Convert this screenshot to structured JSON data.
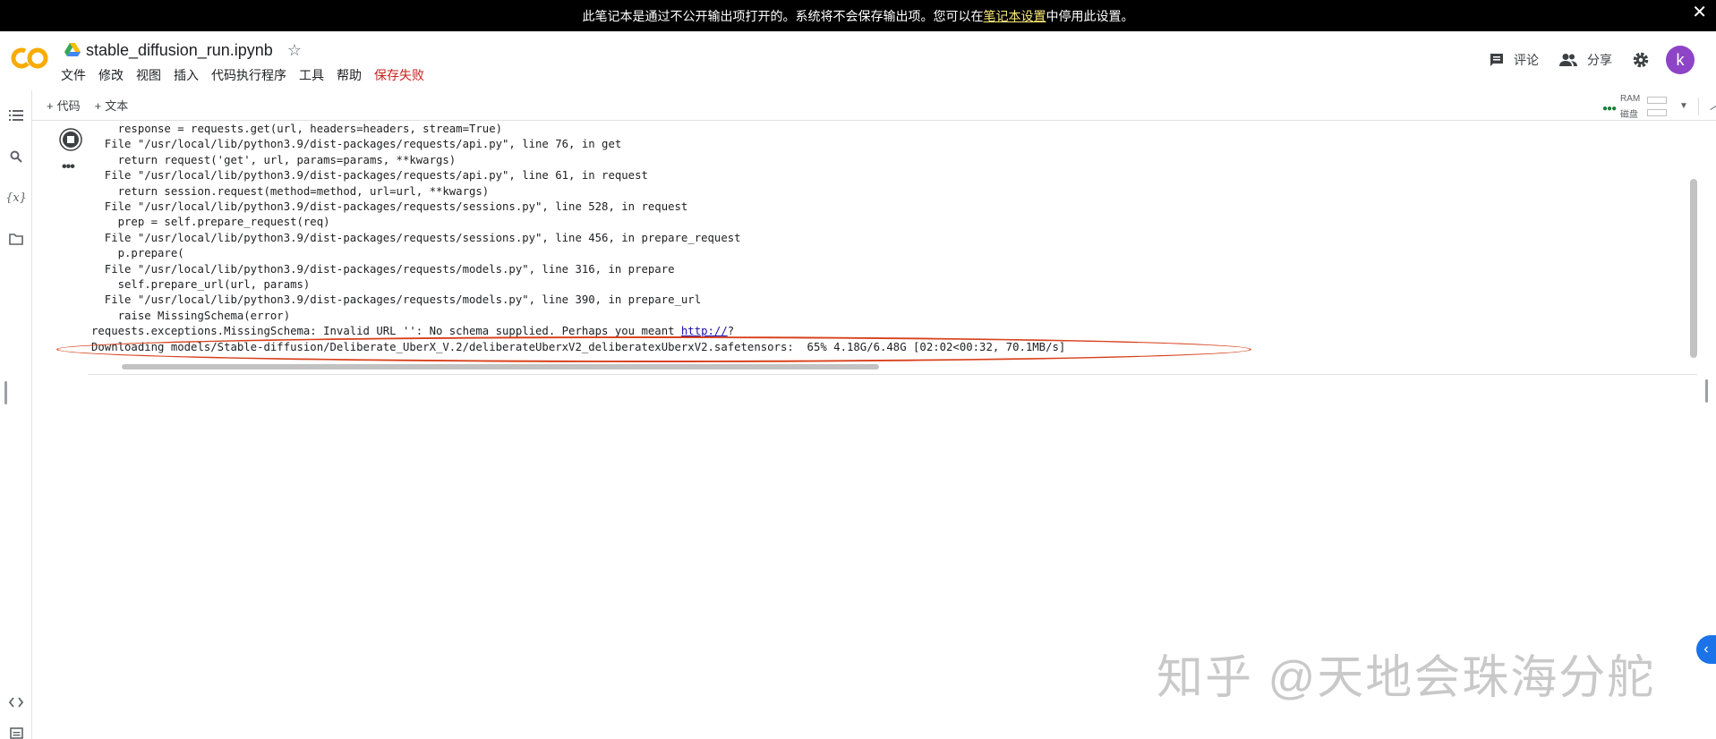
{
  "banner": {
    "text_before": "此笔记本是通过不公开输出项打开的。系统将不会保存输出项。您可以在",
    "link": "笔记本设置",
    "text_after": "中停用此设置。",
    "close": "✕"
  },
  "header": {
    "logo": "colab-logo",
    "notebook_title": "stable_diffusion_run.ipynb",
    "star": "☆",
    "menu": [
      "文件",
      "修改",
      "视图",
      "插入",
      "代码执行程序",
      "工具",
      "帮助"
    ],
    "save_status": "保存失败",
    "comment_label": "评论",
    "share_label": "分享",
    "avatar_letter": "k"
  },
  "toolbar": {
    "add_code": "代码",
    "add_text": "文本",
    "plus": "+",
    "ram_label": "RAM",
    "disk_label": "磁盘"
  },
  "output": {
    "lines": [
      "    response = requests.get(url, headers=headers, stream=True)",
      "  File \"/usr/local/lib/python3.9/dist-packages/requests/api.py\", line 76, in get",
      "    return request('get', url, params=params, **kwargs)",
      "  File \"/usr/local/lib/python3.9/dist-packages/requests/api.py\", line 61, in request",
      "    return session.request(method=method, url=url, **kwargs)",
      "  File \"/usr/local/lib/python3.9/dist-packages/requests/sessions.py\", line 528, in request",
      "    prep = self.prepare_request(req)",
      "  File \"/usr/local/lib/python3.9/dist-packages/requests/sessions.py\", line 456, in prepare_request",
      "    p.prepare(",
      "  File \"/usr/local/lib/python3.9/dist-packages/requests/models.py\", line 316, in prepare",
      "    self.prepare_url(url, params)",
      "  File \"/usr/local/lib/python3.9/dist-packages/requests/models.py\", line 390, in prepare_url",
      "    raise MissingSchema(error)"
    ],
    "exception_text": "requests.exceptions.MissingSchema: Invalid URL '': No schema supplied. Perhaps you meant ",
    "exception_link": "http://",
    "exception_end": "?",
    "download_line": "Downloading models/Stable-diffusion/Deliberate_UberX_V.2/deliberateUberxV2_deliberatexUberxV2.safetensors:  65% 4.18G/6.48G [02:02<00:32, 70.1MB/s]",
    "run_status_icon": "stop-icon",
    "more_label": "•••"
  },
  "watermark": "知乎 @天地会珠海分舵",
  "colors": {
    "accent_orange": "#f9ab00",
    "avatar": "#8e44c7",
    "highlight": "#d8411c",
    "save_failed": "#c5221f"
  }
}
